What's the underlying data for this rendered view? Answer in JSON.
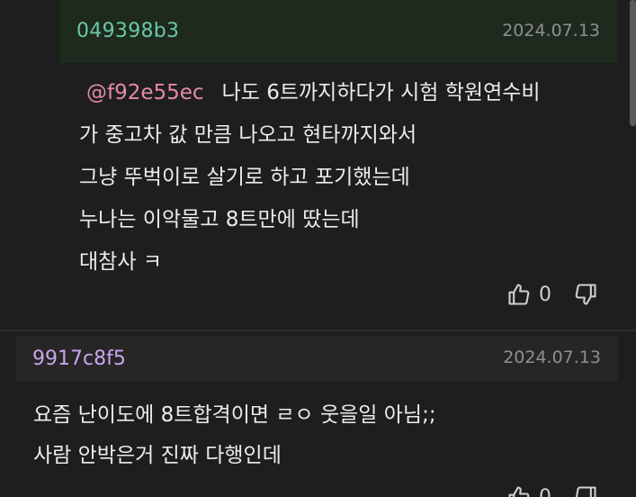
{
  "reply": {
    "author": "049398b3",
    "date": "2024.07.13",
    "mention": "@f92e55ec",
    "lines": [
      "나도 6트까지하다가 시험 학원연수비",
      "가 중고차 값 만큼 나오고 현타까지와서",
      "그냥 뚜벅이로 살기로 하고 포기했는데",
      "누나는 이악물고 8트만에 땄는데",
      "대참사 ㅋ"
    ],
    "likes": "0"
  },
  "comment": {
    "author": "9917c8f5",
    "date": "2024.07.13",
    "lines": [
      "요즘 난이도에 8트합격이면 ㄹㅇ 웃을일 아님;;",
      "사람 안박은거 진짜 다행인데"
    ],
    "likes": "0"
  },
  "colors": {
    "background": "#1e1e1e",
    "reply_header_bg": "#1d2a1d",
    "reply_author": "#6ec6a3",
    "comment_author": "#c8a6ea",
    "mention": "#e58aa6",
    "date": "#8f8f8f"
  },
  "icons": [
    "thumbs-up-icon",
    "thumbs-down-icon"
  ]
}
